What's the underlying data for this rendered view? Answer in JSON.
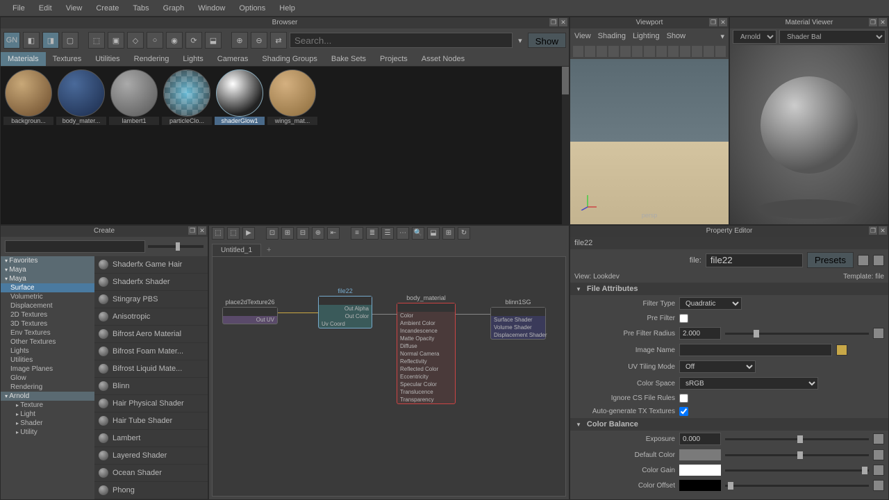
{
  "menubar": [
    "File",
    "Edit",
    "View",
    "Create",
    "Tabs",
    "Graph",
    "Window",
    "Options",
    "Help"
  ],
  "browser": {
    "title": "Browser",
    "search_placeholder": "Search...",
    "show": "Show",
    "tabs": [
      "Materials",
      "Textures",
      "Utilities",
      "Rendering",
      "Lights",
      "Cameras",
      "Shading Groups",
      "Bake Sets",
      "Projects",
      "Asset Nodes"
    ],
    "active_tab": 0,
    "materials": [
      {
        "label": "backgroun...",
        "sel": false
      },
      {
        "label": "body_mater...",
        "sel": false
      },
      {
        "label": "lambert1",
        "sel": false
      },
      {
        "label": "particleClo...",
        "sel": false
      },
      {
        "label": "shaderGlow1",
        "sel": true
      },
      {
        "label": "wings_mat...",
        "sel": false
      }
    ]
  },
  "viewport": {
    "title": "Viewport",
    "menu": [
      "View",
      "Shading",
      "Lighting",
      "Show"
    ],
    "camera": "persp"
  },
  "mat_viewer": {
    "title": "Material Viewer",
    "renderer": "Arnold",
    "shape": "Shader Bal"
  },
  "create": {
    "title": "Create",
    "categories": [
      {
        "t": "hdr",
        "label": "Favorites"
      },
      {
        "t": "hdr",
        "label": "Maya"
      },
      {
        "t": "hdr",
        "label": "Maya"
      },
      {
        "t": "item sel",
        "label": "Surface"
      },
      {
        "t": "item",
        "label": "Volumetric"
      },
      {
        "t": "item",
        "label": "Displacement"
      },
      {
        "t": "item",
        "label": "2D Textures"
      },
      {
        "t": "item",
        "label": "3D Textures"
      },
      {
        "t": "item",
        "label": "Env Textures"
      },
      {
        "t": "item",
        "label": "Other Textures"
      },
      {
        "t": "item",
        "label": "Lights"
      },
      {
        "t": "item",
        "label": "Utilities"
      },
      {
        "t": "item",
        "label": "Image Planes"
      },
      {
        "t": "item",
        "label": "Glow"
      },
      {
        "t": "item",
        "label": "Rendering"
      },
      {
        "t": "hdr",
        "label": "Arnold"
      },
      {
        "t": "sub",
        "label": "Texture"
      },
      {
        "t": "sub",
        "label": "Light"
      },
      {
        "t": "sub",
        "label": "Shader"
      },
      {
        "t": "sub",
        "label": "Utility"
      }
    ],
    "shaders": [
      "Shaderfx Game Hair",
      "Shaderfx Shader",
      "Stingray PBS",
      "Anisotropic",
      "Bifrost Aero Material",
      "Bifrost Foam Mater...",
      "Bifrost Liquid Mate...",
      "Blinn",
      "Hair Physical Shader",
      "Hair Tube Shader",
      "Lambert",
      "Layered Shader",
      "Ocean Shader",
      "Phong"
    ]
  },
  "nodegraph": {
    "tab": "Untitled_1",
    "nodes": {
      "n1": {
        "title": "place2dTexture26",
        "rows": [
          "Out UV"
        ]
      },
      "n2": {
        "title": "file22",
        "rows": [
          "Out Alpha",
          "Out Color",
          "Uv Coord"
        ]
      },
      "n3": {
        "title": "body_material",
        "rows": [
          "Color",
          "Ambient Color",
          "Incandescence",
          "Matte Opacity",
          "Diffuse",
          "Normal Camera",
          "Reflectivity",
          "Reflected Color",
          "Eccentricity",
          "Specular Color",
          "Translucence",
          "Transparency"
        ]
      },
      "n4": {
        "title": "blinn1SG",
        "rows": [
          "Surface Shader",
          "Volume Shader",
          "Displacement Shader"
        ]
      }
    }
  },
  "property": {
    "title": "Property Editor",
    "node": "file22",
    "file_label": "file:",
    "file_value": "file22",
    "presets": "Presets",
    "view_label": "View:",
    "view_value": "Lookdev",
    "template_label": "Template:",
    "template_value": "file",
    "sections": {
      "file_attrs": "File Attributes",
      "color_balance": "Color Balance"
    },
    "attrs": {
      "filter_type": {
        "label": "Filter Type",
        "value": "Quadratic"
      },
      "pre_filter": {
        "label": "Pre Filter"
      },
      "pre_filter_radius": {
        "label": "Pre Filter Radius",
        "value": "2.000"
      },
      "image_name": {
        "label": "Image Name",
        "value": ""
      },
      "uv_tiling": {
        "label": "UV Tiling Mode",
        "value": "Off"
      },
      "color_space": {
        "label": "Color Space",
        "value": "sRGB"
      },
      "ignore_cs": {
        "label": "Ignore CS File Rules"
      },
      "auto_tx": {
        "label": "Auto-generate TX Textures"
      },
      "exposure": {
        "label": "Exposure",
        "value": "0.000"
      },
      "default_color": {
        "label": "Default Color"
      },
      "color_gain": {
        "label": "Color Gain"
      },
      "color_offset": {
        "label": "Color Offset"
      }
    }
  }
}
